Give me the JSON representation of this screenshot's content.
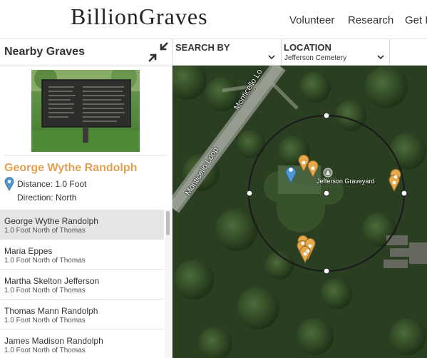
{
  "header": {
    "logo": "BillionGraves",
    "nav": [
      "Volunteer",
      "Research",
      "Get H"
    ]
  },
  "panel": {
    "title": "Nearby Graves",
    "collapse_icon": "collapse-arrows-icon"
  },
  "selected": {
    "name": "George Wythe Randolph",
    "distance": "Distance: 1.0 Foot",
    "direction": "Direction: North",
    "pin_icon": "map-pin-icon"
  },
  "list": [
    {
      "name": "George Wythe Randolph",
      "sub": "1.0 Foot North of Thomas"
    },
    {
      "name": "Maria Eppes",
      "sub": "1.0 Foot North of Thomas"
    },
    {
      "name": "Martha Skelton Jefferson",
      "sub": "1.0 Foot North of Thomas"
    },
    {
      "name": "Thomas Mann Randolph",
      "sub": "1.0 Foot North of Thomas"
    },
    {
      "name": "James Madison Randolph",
      "sub": "1.0 Foot North of Thomas"
    }
  ],
  "filters": {
    "search_by": "SEARCH BY",
    "location_label": "LOCATION",
    "location_value": "Jefferson Cemetery"
  },
  "map": {
    "roads": [
      "Monticello Loop",
      "Monticello Lo"
    ],
    "place_label": "Jefferson Graveyard"
  },
  "colors": {
    "accent": "#e2a053",
    "pin_blue": "#4f97d1",
    "pin_gold": "#e8a94d"
  }
}
